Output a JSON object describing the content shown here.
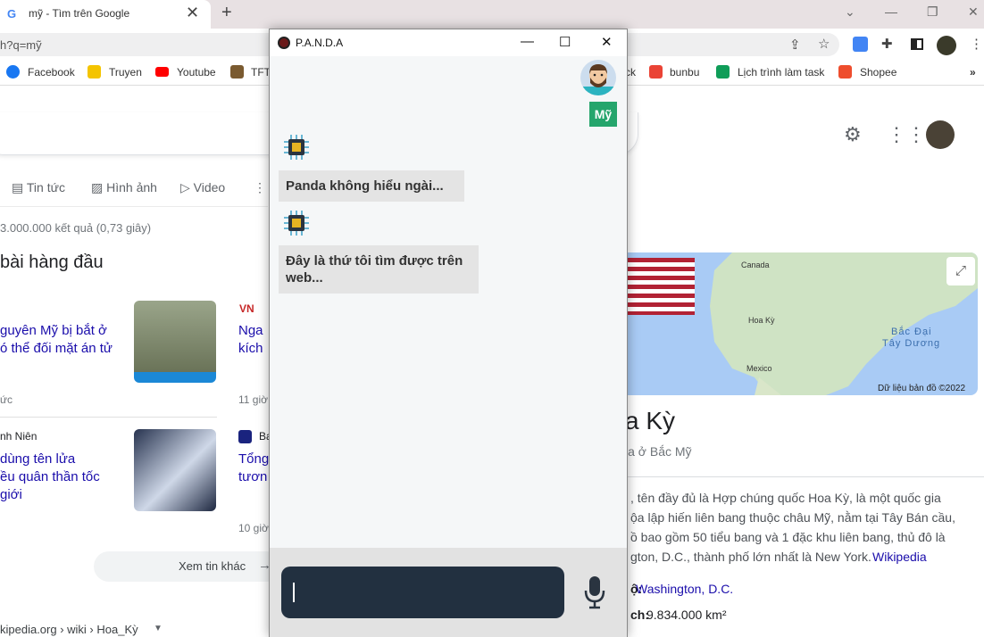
{
  "browser": {
    "tab_title": "mỹ - Tìm trên Google",
    "url": "h?q=mỹ",
    "bookmarks": [
      "Facebook",
      "Truyen",
      "Youtube",
      "TFT",
      "ck",
      "bunbu",
      "Lịch trình làm task",
      "Shopee"
    ]
  },
  "google": {
    "tabs": [
      "Tin tức",
      "Hình ảnh",
      "Video"
    ],
    "result_count": "3.000.000 kết quả (0,73 giây)",
    "top_stories": "bài hàng đầu",
    "news": [
      {
        "line1": "guyên Mỹ bị bắt ở",
        "line2": "ó thể đối mặt án tử",
        "meta": "ức"
      },
      {
        "line1": "Nga",
        "line2": "kích",
        "meta": "11 giờ"
      },
      {
        "source": "nh Niên",
        "line1": "dùng tên lửa",
        "line2": "ều quân thần tốc",
        "line3": "giới"
      },
      {
        "source": "Ba",
        "line1": "Tổng",
        "line2": "tươn",
        "meta": "10 giờ"
      }
    ],
    "more_news": "Xem tin khác",
    "breadcrumb": "kipedia.org › wiki › Hoa_Kỳ"
  },
  "knowledge": {
    "map_labels": {
      "canada": "Canada",
      "hoaky": "Hoa Kỳ",
      "mexico": "Mexico",
      "ocean1": "Bắc Đại",
      "ocean2": "Tây Dương",
      "credit": "Dữ liệu bản đồ ©2022"
    },
    "title": "a Kỳ",
    "subtitle": "ia ở Bắc Mỹ",
    "desc": [
      ", tên đầy đủ là Hợp chúng quốc Hoa Kỳ, là một quốc gia",
      "ộa lập hiến liên bang thuộc châu Mỹ, nằm tại Tây Bán cầu,",
      "ồ bao gồm 50 tiểu bang và 1 đặc khu liên bang, thủ đô là",
      "gton, D.C., thành phố lớn nhất là New York."
    ],
    "wiki_link": "Wikipedia",
    "capital_label": "ộ:",
    "capital": "Washington, D.C.",
    "area_label": "ch:",
    "area": "9.834.000 km²"
  },
  "panda": {
    "title": "P.A.N.D.A",
    "user_message": "Mỹ",
    "bot_messages": [
      "Panda không hiểu ngài...",
      "Đây là thứ tôi tìm được trên web..."
    ],
    "input_value": ""
  }
}
